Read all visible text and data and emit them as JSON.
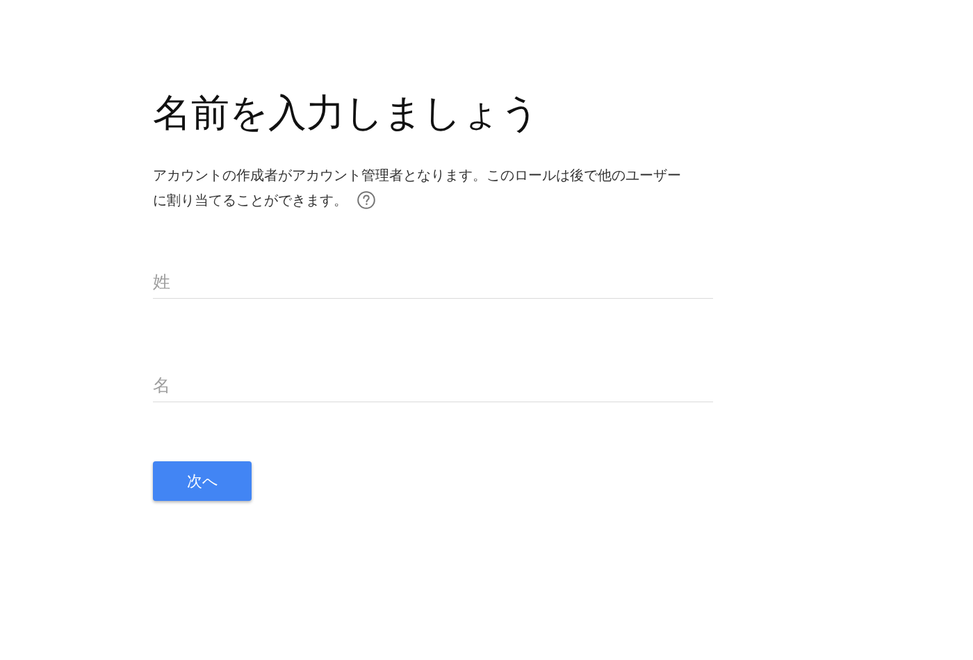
{
  "title": "名前を入力しましょう",
  "description_lines": [
    "アカウントの作成者がアカウント管理者となります。このロールは後で他のユーザー",
    "に割り当てることができます。"
  ],
  "fields": [
    {
      "placeholder": "姓"
    },
    {
      "placeholder": "名"
    }
  ],
  "next_button": {
    "label": "次へ"
  }
}
